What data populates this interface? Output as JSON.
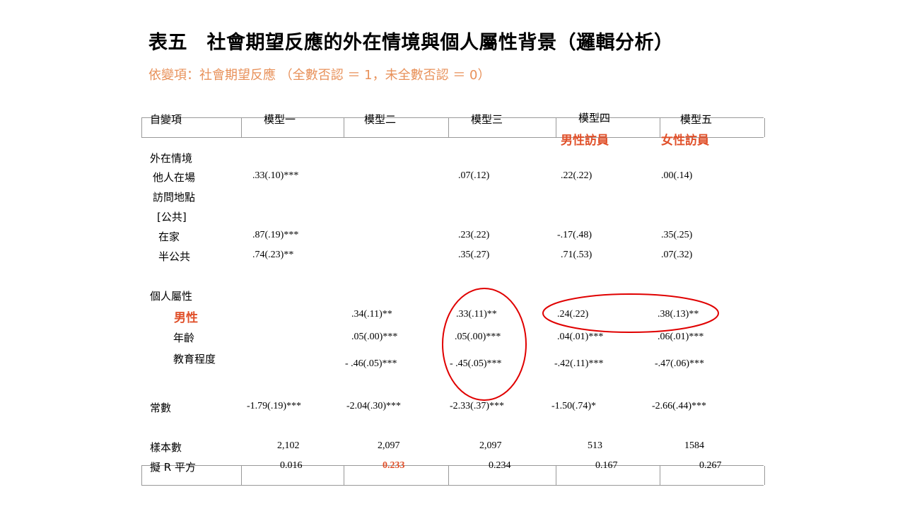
{
  "title": "表五　社會期望反應的外在情境與個人屬性背景（邏輯分析）",
  "subtitle": "依變項：社會期望反應 （全數否認 ＝ 1，未全數否認 ＝ 0）",
  "header": {
    "var_col": "自變項",
    "models": [
      "模型一",
      "模型二",
      "模型三",
      "模型四",
      "模型五"
    ],
    "m4_sub": "男性訪員",
    "m5_sub": "女性訪員"
  },
  "sections": {
    "external": "外在情境",
    "personal": "個人屬性"
  },
  "rows": {
    "others_present": {
      "label": "他人在場",
      "vals": [
        ".33(.10)***",
        "",
        ".07(.12)",
        ".22(.22)",
        ".00(.14)"
      ]
    },
    "location": {
      "label": "訪問地點"
    },
    "public_ref": {
      "label": "[公共]"
    },
    "home": {
      "label": "在家",
      "vals": [
        ".87(.19)***",
        "",
        ".23(.22)",
        "-.17(.48)",
        ".35(.25)"
      ]
    },
    "semi_public": {
      "label": "半公共",
      "vals": [
        ".74(.23)**",
        "",
        ".35(.27)",
        ".71(.53)",
        ".07(.32)"
      ]
    },
    "male": {
      "label": "男性",
      "vals": [
        "",
        ".34(.11)**",
        ".33(.11)**",
        ".24(.22)",
        ".38(.13)**"
      ]
    },
    "age": {
      "label": "年齡",
      "vals": [
        "",
        ".05(.00)***",
        ".05(.00)***",
        ".04(.01)***",
        ".06(.01)***"
      ]
    },
    "education": {
      "label": "教育程度",
      "vals": [
        "",
        "- .46(.05)***",
        "- .45(.05)***",
        "-.42(.11)***",
        "-.47(.06)***"
      ]
    },
    "constant": {
      "label": "常數",
      "vals": [
        "-1.79(.19)***",
        "-2.04(.30)***",
        "-2.33(.37)***",
        "-1.50(.74)*",
        "-2.66(.44)***"
      ]
    },
    "n": {
      "label": "樣本數",
      "vals": [
        "2,102",
        "2,097",
        "2,097",
        "513",
        "1584"
      ]
    },
    "pseudo_r2": {
      "label": "擬 R 平方",
      "vals": [
        "0.016",
        "0.233",
        "0.234",
        "0.167",
        "0.267"
      ]
    }
  },
  "colors": {
    "subtitle": "#e8915a",
    "highlight": "#e0502a",
    "annotation": "#e00000",
    "grid": "#999999"
  }
}
